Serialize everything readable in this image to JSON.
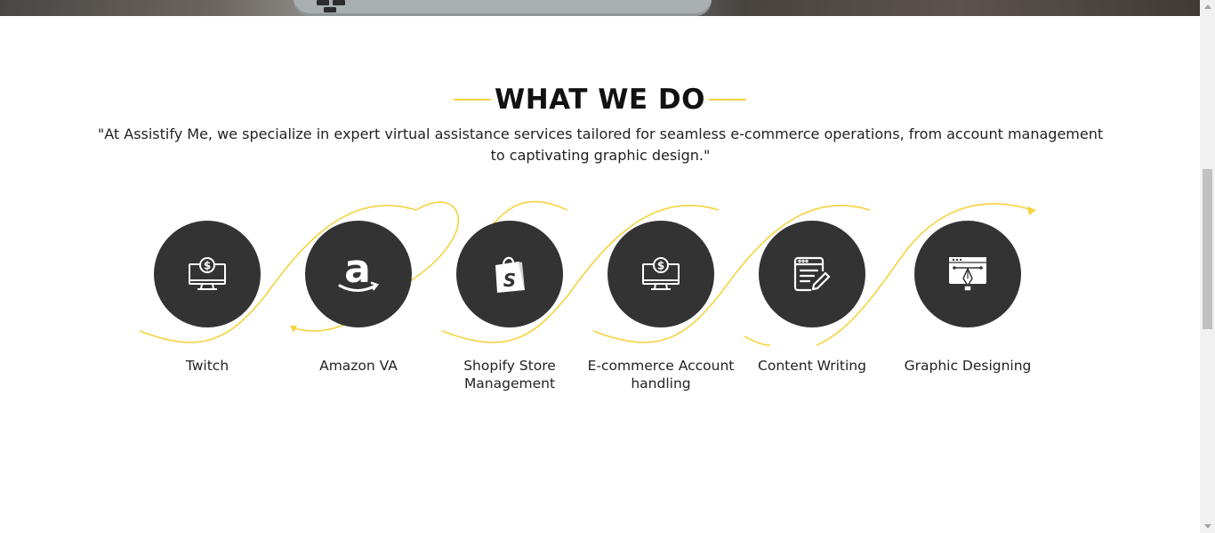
{
  "section": {
    "title": "WHAT WE DO",
    "intro": "\"At Assistify Me, we specialize in expert virtual assistance services tailored for seamless e-commerce operations, from account management to captivating graphic design.\""
  },
  "colors": {
    "accent": "#f5d33f",
    "circle": "#333333",
    "text": "#222222"
  },
  "services": [
    {
      "label": "Twitch",
      "icon": "monitor-dollar-icon"
    },
    {
      "label": "Amazon VA",
      "icon": "amazon-logo-icon"
    },
    {
      "label": "Shopify Store Management",
      "icon": "shopify-bag-icon"
    },
    {
      "label": "E-commerce Account handling",
      "icon": "monitor-dollar-icon"
    },
    {
      "label": "Content Writing",
      "icon": "document-pen-icon"
    },
    {
      "label": "Graphic Designing",
      "icon": "pen-tool-window-icon"
    }
  ]
}
